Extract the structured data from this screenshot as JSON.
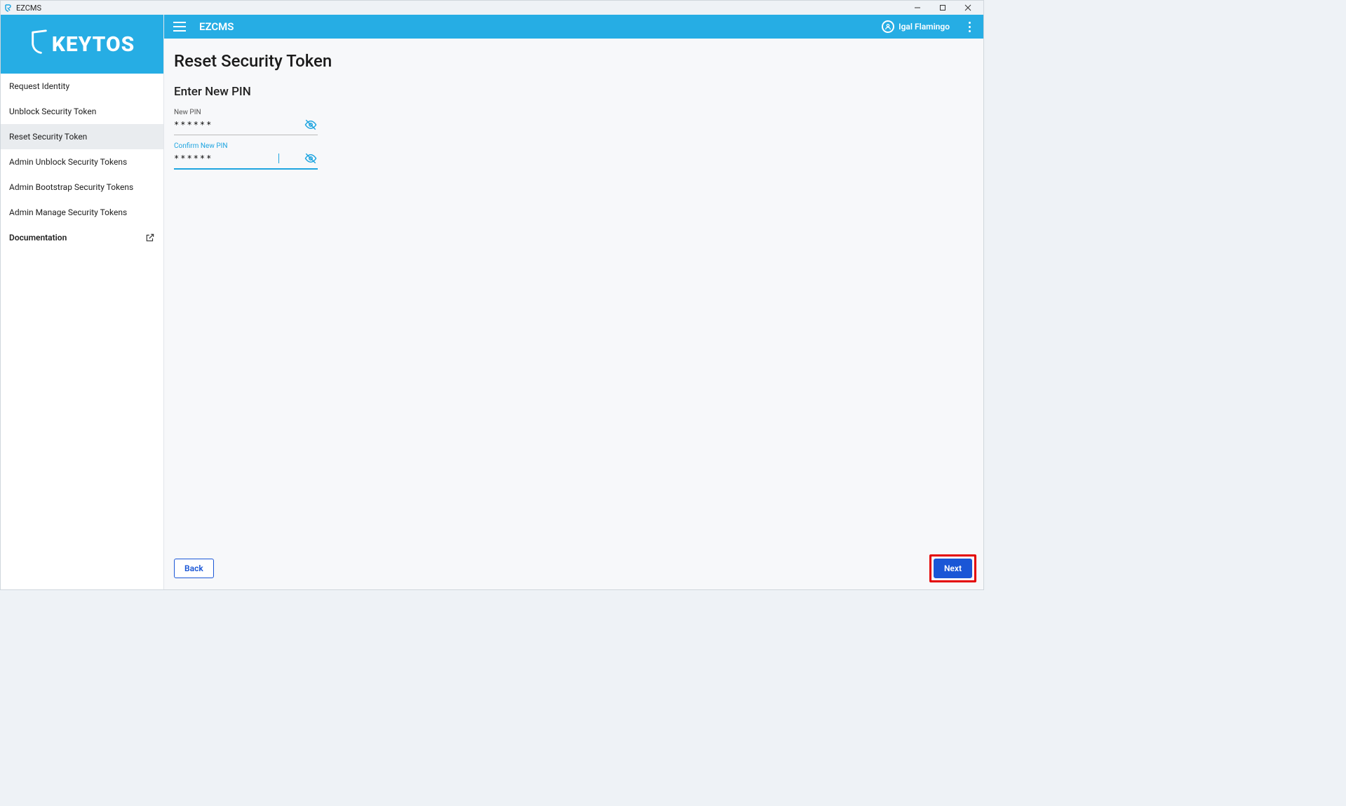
{
  "window": {
    "title": "EZCMS"
  },
  "topbar": {
    "app_name": "EZCMS",
    "user_name": "Igal Flamingo"
  },
  "sidebar": {
    "logo_text": "KEYTOS",
    "items": [
      {
        "label": "Request Identity"
      },
      {
        "label": "Unblock Security Token"
      },
      {
        "label": "Reset Security Token"
      },
      {
        "label": "Admin Unblock Security Tokens"
      },
      {
        "label": "Admin Bootstrap Security Tokens"
      },
      {
        "label": "Admin Manage Security Tokens"
      }
    ],
    "documentation_label": "Documentation"
  },
  "page": {
    "title": "Reset Security Token",
    "section_title": "Enter New PIN",
    "new_pin_label": "New PIN",
    "new_pin_value": "******",
    "confirm_pin_label": "Confirm New PIN",
    "confirm_pin_value": "******",
    "back_label": "Back",
    "next_label": "Next"
  }
}
